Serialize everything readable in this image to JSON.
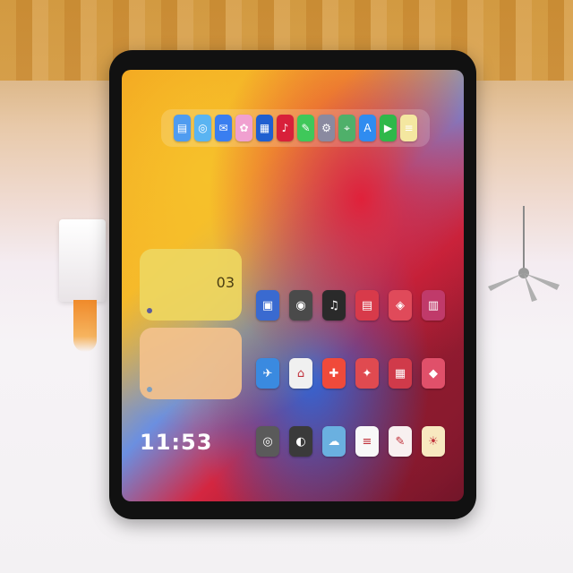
{
  "background": {
    "wall_colors": [
      "#d49a3e",
      "#f4ecf1"
    ],
    "lamp_accent": "#f08a2a"
  },
  "device": {
    "frame_color": "#111111"
  },
  "dock": {
    "apps": [
      {
        "name": "files-icon",
        "color": "#4f9cf0",
        "glyph": "▤"
      },
      {
        "name": "safari-icon",
        "color": "#5ab4f2",
        "glyph": "◎"
      },
      {
        "name": "mail-icon",
        "color": "#3a7ef0",
        "glyph": "✉"
      },
      {
        "name": "photos-icon",
        "color": "#f0a0d0",
        "glyph": "✿"
      },
      {
        "name": "calendar-icon",
        "color": "#1f5fd0",
        "glyph": "▦"
      },
      {
        "name": "music-icon",
        "color": "#d8203a",
        "glyph": "♪"
      },
      {
        "name": "messages-icon",
        "color": "#3fc85a",
        "glyph": "✎"
      },
      {
        "name": "settings-icon",
        "color": "#8a8aa0",
        "glyph": "⚙"
      },
      {
        "name": "maps-icon",
        "color": "#4fb06a",
        "glyph": "⌖"
      },
      {
        "name": "appstore-icon",
        "color": "#2f8cf0",
        "glyph": "A"
      },
      {
        "name": "facetime-icon",
        "color": "#2fb84a",
        "glyph": "▶"
      },
      {
        "name": "notes-icon",
        "color": "#f4e7a0",
        "glyph": "≡"
      }
    ]
  },
  "widgets": {
    "calendar": {
      "title": "",
      "text": "",
      "date": "03"
    },
    "notes": {
      "title": "",
      "text": ""
    }
  },
  "clock": {
    "date": "",
    "time": "11:53"
  },
  "grid": {
    "apps": [
      {
        "name": "app-icon-1",
        "color": "#3a6ad0",
        "glyph": "▣"
      },
      {
        "name": "app-icon-2",
        "color": "#4a4a4a",
        "glyph": "◉"
      },
      {
        "name": "app-icon-3",
        "color": "#2a2a2a",
        "glyph": "♫"
      },
      {
        "name": "app-icon-4",
        "color": "#d83a4a",
        "glyph": "▤"
      },
      {
        "name": "app-icon-5",
        "color": "#e04a5a",
        "glyph": "◈"
      },
      {
        "name": "app-icon-6",
        "color": "#c03a6a",
        "glyph": "▥"
      },
      {
        "name": "app-icon-7",
        "color": "#3a8ae0",
        "glyph": "✈"
      },
      {
        "name": "app-icon-8",
        "color": "#f0f0f0",
        "glyph": "⌂"
      },
      {
        "name": "app-icon-9",
        "color": "#f04a3a",
        "glyph": "✚"
      },
      {
        "name": "app-icon-10",
        "color": "#e04a50",
        "glyph": "✦"
      },
      {
        "name": "app-icon-11",
        "color": "#d03a4a",
        "glyph": "▦"
      },
      {
        "name": "app-icon-12",
        "color": "#e0506a",
        "glyph": "◆"
      },
      {
        "name": "app-icon-13",
        "color": "#5a5a5a",
        "glyph": "◎"
      },
      {
        "name": "app-icon-14",
        "color": "#3a3a3a",
        "glyph": "◐"
      },
      {
        "name": "app-icon-15",
        "color": "#6ab0e0",
        "glyph": "☁"
      },
      {
        "name": "app-icon-16",
        "color": "#f8f8f8",
        "glyph": "≡"
      },
      {
        "name": "app-icon-17",
        "color": "#f8f0f0",
        "glyph": "✎"
      },
      {
        "name": "app-icon-18",
        "color": "#f8e8c0",
        "glyph": "☀"
      }
    ]
  }
}
